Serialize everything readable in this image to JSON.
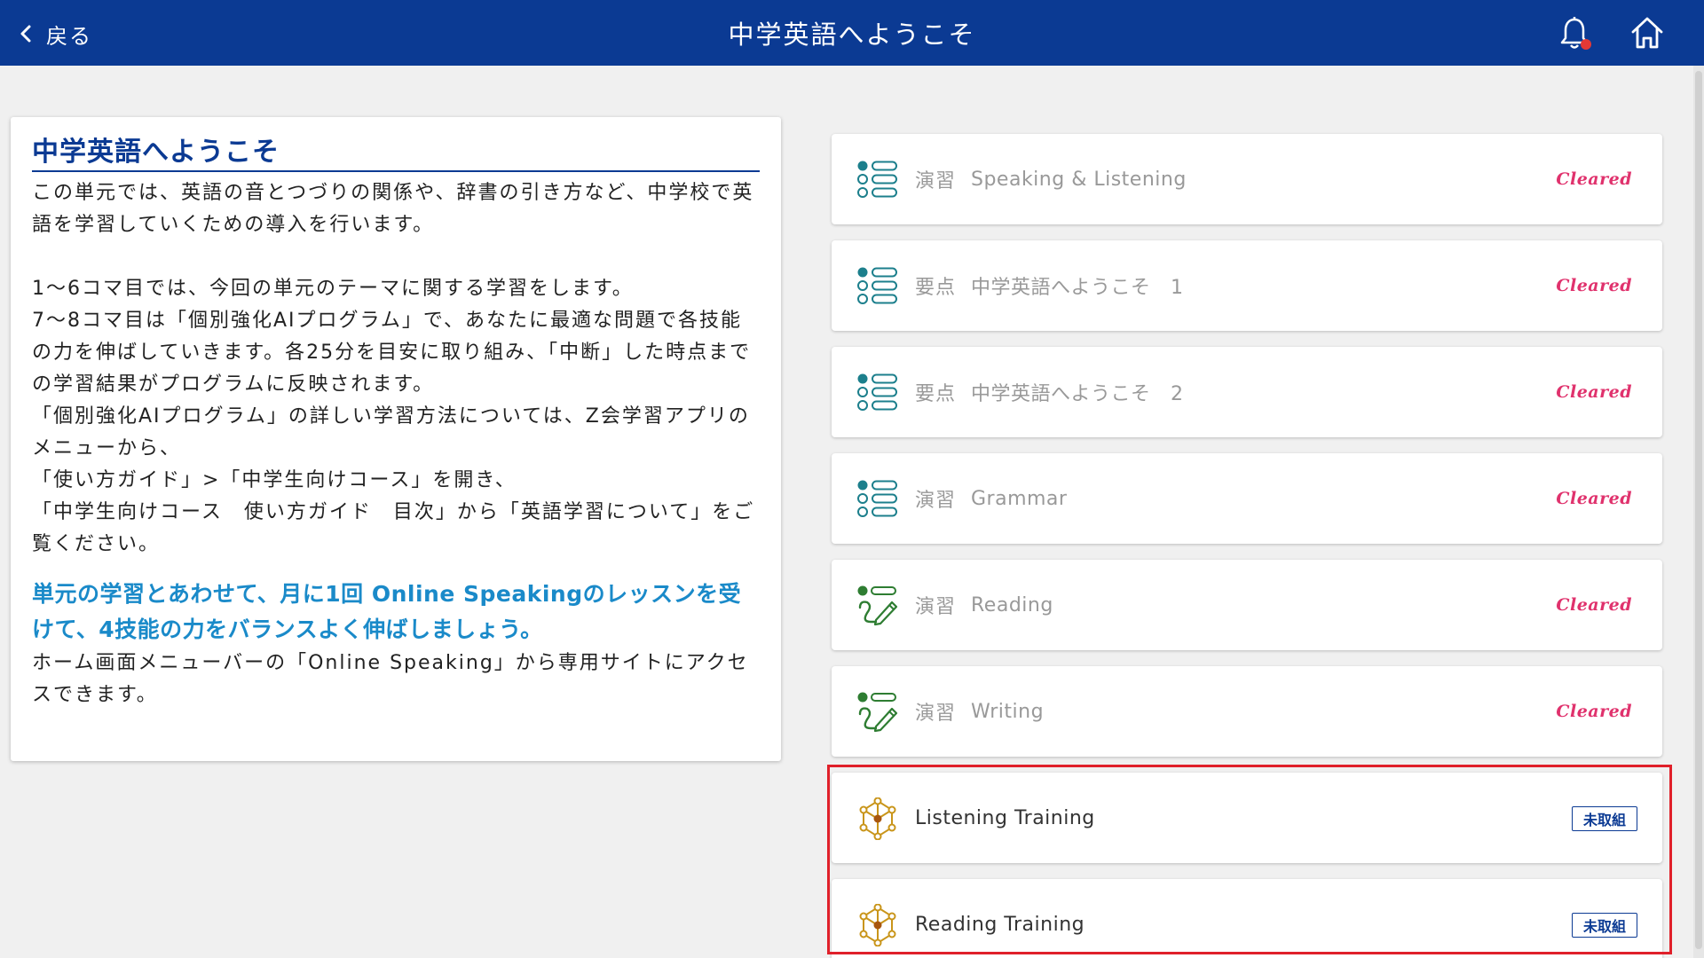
{
  "header": {
    "back_label": "戻る",
    "title": "中学英語へようこそ"
  },
  "intro": {
    "title": "中学英語へようこそ",
    "para1": "この単元では、英語の音とつづりの関係や、辞書の引き方など、中学校で英語を学習していくための導入を行います。",
    "para2_lines": [
      "1〜6コマ目では、今回の単元のテーマに関する学習をします。",
      "7〜8コマ目は「個別強化AIプログラム」で、あなたに最適な問題で各技能の力を伸ばしていきます。各25分を目安に取り組み、「中断」した時点までの学習結果がプログラムに反映されます。",
      "「個別強化AIプログラム」の詳しい学習方法については、Z会学習アプリのメニューから、",
      "「使い方ガイド」>「中学生向けコース」を開き、",
      "「中学生向けコース　使い方ガイド　目次」から「英語学習について」をご覧ください。"
    ],
    "highlight": "単元の学習とあわせて、月に1回 Online Speakingのレッスンを受けて、4技能の力をバランスよく伸ばしましょう。",
    "footer_text": "ホーム画面メニューバーの「Online Speaking」から専用サイトにアクセスできます。"
  },
  "units": [
    {
      "category": "演習",
      "name": "Speaking & Listening",
      "status": "Cleared",
      "icon": "list-icon"
    },
    {
      "category": "要点",
      "name": "中学英語へようこそ　1",
      "status": "Cleared",
      "icon": "list-icon"
    },
    {
      "category": "要点",
      "name": "中学英語へようこそ　2",
      "status": "Cleared",
      "icon": "list-icon"
    },
    {
      "category": "演習",
      "name": "Grammar",
      "status": "Cleared",
      "icon": "list-icon"
    },
    {
      "category": "演習",
      "name": "Reading",
      "status": "Cleared",
      "icon": "pencil-icon"
    },
    {
      "category": "演習",
      "name": "Writing",
      "status": "Cleared",
      "icon": "pencil-icon"
    },
    {
      "category": "",
      "name": "Listening Training",
      "status": "未取組",
      "icon": "ai-network-icon"
    },
    {
      "category": "",
      "name": "Reading Training",
      "status": "未取組",
      "icon": "ai-network-icon"
    }
  ],
  "colors": {
    "header_bg": "#0b3a93",
    "cleared": "#e0326d",
    "highlight_text": "#1a8ac9",
    "list_icon": "#1c7f8c",
    "pencil_icon": "#2e7d32",
    "ai_icon": "#c9951a",
    "highlight_box": "#e0202a"
  }
}
